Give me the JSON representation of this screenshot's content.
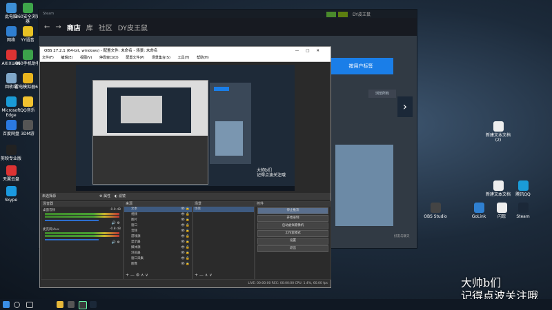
{
  "desktop_left": [
    {
      "label": "此电脑",
      "color": "#3d8fd6"
    },
    {
      "label": "360安全浏览器",
      "color": "#3ea54a"
    },
    {
      "label": "网络",
      "color": "#2f7fd1"
    },
    {
      "label": "YY语音",
      "color": "#e8c224"
    },
    {
      "label": "AXIXUAN",
      "color": "#d33"
    },
    {
      "label": "360手机助手",
      "color": "#3ca24b"
    },
    {
      "label": "回收站",
      "color": "#7fa7c9"
    },
    {
      "label": "雷电模拟器64",
      "color": "#e8b41e"
    },
    {
      "label": "Microsoft Edge",
      "color": "#1a9bd7"
    },
    {
      "label": "QQ音乐",
      "color": "#f1c230"
    },
    {
      "label": "百度网盘",
      "color": "#2b79e0"
    },
    {
      "label": "3DM游",
      "color": "#555"
    },
    {
      "label": "剪映专业版",
      "color": "#222"
    },
    {
      "label": "天翼云盘",
      "color": "#d33"
    },
    {
      "label": "Skype",
      "color": "#1b9ae0"
    }
  ],
  "desktop_right": [
    {
      "label": "新建文本文档(2)",
      "color": "#eee"
    },
    {
      "label": "新建文本文档",
      "color": "#eee"
    },
    {
      "label": "腾讯QQ",
      "color": "#1a9bd7"
    },
    {
      "label": "OBS Studio",
      "color": "#444"
    },
    {
      "label": "GoLink",
      "color": "#2f80d1"
    },
    {
      "label": "闪现",
      "color": "#eee"
    },
    {
      "label": "Steam",
      "color": "#1b2838"
    }
  ],
  "steam": {
    "nav": [
      "←",
      "→",
      "商店",
      "库",
      "社区",
      "DY皮王鼠"
    ],
    "user": "DY皮王鼠",
    "blue_button": "按用户标签",
    "grey_button": "浏览所有",
    "friends": "好友与聊天"
  },
  "obs": {
    "title": "OBS 27.2.1 (64-bit, windows) - 配置文件: 未命名 - 场景: 未命名",
    "window_controls": [
      "—",
      "□",
      "✕"
    ],
    "menu": [
      "文件(F)",
      "编辑(E)",
      "视图(V)",
      "停靠窗口(D)",
      "配置文件(P)",
      "场景集合(S)",
      "工具(T)",
      "帮助(H)"
    ],
    "scene_bar": {
      "no_source": "未选择源",
      "properties": "属性",
      "filters": "滤镜"
    },
    "mixer": {
      "title": "混音器",
      "tracks": [
        {
          "name": "桌面音频",
          "db": "-0.0 dB"
        },
        {
          "name": "麦克风/Aux",
          "db": "-0.8 dB"
        }
      ]
    },
    "scenes": {
      "title": "场景",
      "items": [
        "场景"
      ]
    },
    "sources": {
      "title": "来源",
      "items": [
        "文本",
        "视频",
        "图片",
        "窗口",
        "音频",
        "游戏源",
        "显示器",
        "媒体源",
        "浏览器",
        "窗口采集",
        "图像"
      ]
    },
    "controls": {
      "title": "控件",
      "buttons": [
        "停止推流",
        "开始录制",
        "启动虚拟摄像机",
        "工作室模式",
        "设置",
        "退出"
      ]
    },
    "status": "LIVE: 00:00:00  REC: 00:00:00  CPU: 1.4%, 60.00 fps"
  },
  "watermark": {
    "line1": "大帅b们",
    "line2": "记得点波关注哦"
  },
  "taskbar": {
    "icons": [
      "start",
      "search",
      "taskview",
      "explorer",
      "obs",
      "steam"
    ]
  }
}
